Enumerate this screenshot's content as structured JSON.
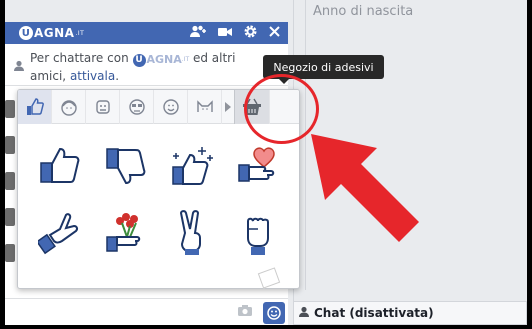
{
  "profile": {
    "birth_label": "Anno di nascita"
  },
  "chat_header": {
    "logo_mark": "U",
    "logo_text": "AGNA",
    "logo_suffix": ".IT",
    "icons": [
      "add-friend-icon",
      "video-icon",
      "settings-icon",
      "close-icon"
    ]
  },
  "notice": {
    "prefix": "Per chattare con",
    "logo_mark": "U",
    "logo_text": "AGNA",
    "logo_suffix": ".IT",
    "suffix": "ed altri amici,",
    "link": "attivala",
    "end": "."
  },
  "sticker_picker": {
    "tabs": [
      {
        "icon": "thumbs-up-tab-icon",
        "active": true
      },
      {
        "icon": "girl-face-tab-icon",
        "active": false
      },
      {
        "icon": "robot-face-tab-icon",
        "active": false
      },
      {
        "icon": "glasses-face-tab-icon",
        "active": false
      },
      {
        "icon": "smiley-tab-icon",
        "active": false
      },
      {
        "icon": "cat-tab-icon",
        "active": false
      },
      {
        "icon": "store-basket-icon",
        "active": false
      }
    ],
    "stickers": [
      "thumbs-up-sticker",
      "thumbs-down-sticker",
      "sparkle-thumbs-up-sticker",
      "heart-hand-sticker",
      "hang-loose-sticker",
      "flowers-hand-sticker",
      "peace-sign-sticker",
      "fist-sticker"
    ],
    "store_tooltip": "Negozio di adesivi"
  },
  "chat_bar": {
    "status_label": "Chat (disattivata)"
  },
  "colors": {
    "accent": "#4267b2",
    "annotation": "#e6262b"
  }
}
